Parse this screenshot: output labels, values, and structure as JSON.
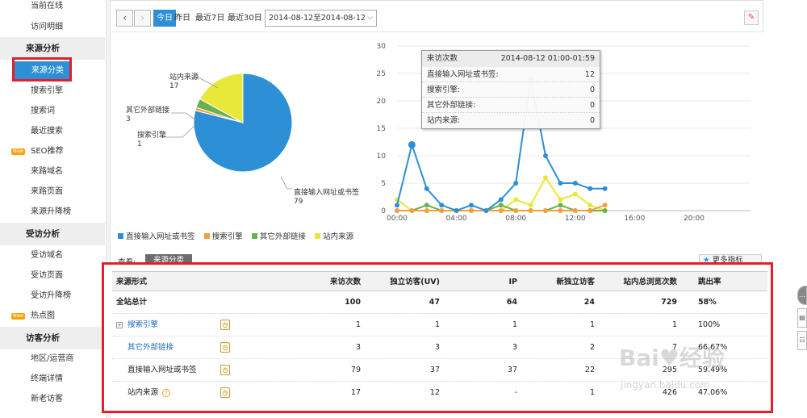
{
  "sidebar": {
    "items": [
      {
        "label": "当前在线",
        "type": "item"
      },
      {
        "label": "访问明细",
        "type": "item"
      },
      {
        "label": "来源分析",
        "type": "section"
      },
      {
        "label": "来源分类",
        "type": "item",
        "active": true
      },
      {
        "label": "搜索引擎",
        "type": "item"
      },
      {
        "label": "搜索词",
        "type": "item"
      },
      {
        "label": "最近搜索",
        "type": "item"
      },
      {
        "label": "SEO推荐",
        "type": "item",
        "badge": "New"
      },
      {
        "label": "来路域名",
        "type": "item"
      },
      {
        "label": "来路页面",
        "type": "item"
      },
      {
        "label": "来源升降榜",
        "type": "item"
      },
      {
        "label": "受访分析",
        "type": "section"
      },
      {
        "label": "受访域名",
        "type": "item"
      },
      {
        "label": "受访页面",
        "type": "item"
      },
      {
        "label": "受访升降榜",
        "type": "item"
      },
      {
        "label": "热点图",
        "type": "item",
        "badge": "New"
      },
      {
        "label": "访客分析",
        "type": "section"
      },
      {
        "label": "地区/运营商",
        "type": "item"
      },
      {
        "label": "终端详情",
        "type": "item"
      },
      {
        "label": "新老访客",
        "type": "item"
      }
    ]
  },
  "toolbar": {
    "prev_icon": "chevron-left-icon",
    "next_icon": "chevron-right-icon",
    "prev_glyph": "‹",
    "next_glyph": "›",
    "ranges": [
      "今日",
      "昨日",
      "最近7日",
      "最近30日"
    ],
    "date_range": "2014-08-12至2014-08-12",
    "date_chevron": "⌵",
    "pin_glyph": "✎"
  },
  "legend": {
    "items": [
      {
        "label": "直接输入网址或书签",
        "color": "#2d8fd5"
      },
      {
        "label": "搜索引擎",
        "color": "#f0a040"
      },
      {
        "label": "其它外部链接",
        "color": "#6ab04c"
      },
      {
        "label": "站内来源",
        "color": "#e8e83a"
      }
    ]
  },
  "chart_data": [
    {
      "type": "pie",
      "slices": [
        {
          "label": "直接输入网址或书签",
          "value": 79,
          "color": "#2d8fd5"
        },
        {
          "label": "搜索引擎",
          "value": 1,
          "color": "#f0a040"
        },
        {
          "label": "其它外部链接",
          "value": 3,
          "color": "#6ab04c"
        },
        {
          "label": "站内来源",
          "value": 17,
          "color": "#e8e83a"
        }
      ]
    },
    {
      "type": "line",
      "x_ticks": [
        "00:00",
        "04:00",
        "08:00",
        "12:00",
        "16:00",
        "20:00"
      ],
      "y_ticks": [
        0,
        5,
        10,
        15,
        20,
        25,
        30
      ],
      "ylim": [
        0,
        30
      ],
      "x_hours": [
        0,
        1,
        2,
        3,
        4,
        5,
        6,
        7,
        8,
        9,
        10,
        11,
        12,
        13,
        14
      ],
      "series": [
        {
          "name": "直接输入网址或书签",
          "color": "#2d8fd5",
          "values": [
            1,
            12,
            4,
            1,
            0,
            1,
            0,
            2,
            5,
            24,
            10,
            5,
            5,
            4,
            4
          ]
        },
        {
          "name": "搜索引擎",
          "color": "#f0a040",
          "values": [
            0,
            0,
            0,
            0,
            0,
            0,
            0,
            0,
            0,
            0,
            0,
            0,
            0,
            0,
            1
          ]
        },
        {
          "name": "其它外部链接",
          "color": "#6ab04c",
          "values": [
            0,
            0,
            1,
            0,
            0,
            0,
            0,
            1,
            0,
            0,
            0,
            1,
            0,
            0,
            0
          ]
        },
        {
          "name": "站内来源",
          "color": "#e8e83a",
          "values": [
            2,
            0,
            0,
            0,
            0,
            0,
            0,
            0,
            2,
            1,
            6,
            2,
            3,
            1,
            0
          ]
        }
      ]
    }
  ],
  "pie_labels": {
    "direct": {
      "name": "直接输入网址或书签",
      "value": "79"
    },
    "search": {
      "name": "搜索引擎",
      "value": "1"
    },
    "external": {
      "name": "其它外部链接",
      "value": "3"
    },
    "internal": {
      "name": "站内来源",
      "value": "17"
    }
  },
  "tooltip": {
    "title": "来访次数",
    "time": "2014-08-12 01:00-01:59",
    "rows": [
      {
        "label": "直接输入网址或书签:",
        "value": "12"
      },
      {
        "label": "搜索引擎:",
        "value": "0"
      },
      {
        "label": "其它外部链接:",
        "value": "0"
      },
      {
        "label": "站内来源:",
        "value": "0"
      }
    ]
  },
  "view": {
    "label": "查看:",
    "tab": "来源分类",
    "more": "更多指标"
  },
  "table": {
    "headers": [
      "来源形式",
      "来访次数",
      "独立访客(UV)",
      "IP",
      "新独立访客",
      "站内总浏览次数",
      "跳出率"
    ],
    "total": {
      "name": "全站总计",
      "visits": "100",
      "uv": "47",
      "ip": "64",
      "new": "24",
      "pv": "729",
      "bounce": "58%"
    },
    "rows": [
      {
        "name": "搜索引擎",
        "visits": "1",
        "uv": "1",
        "ip": "1",
        "new": "1",
        "pv": "1",
        "bounce": "100%",
        "expand": "+"
      },
      {
        "name": "其它外部链接",
        "visits": "3",
        "uv": "3",
        "ip": "3",
        "new": "2",
        "pv": "7",
        "bounce": "66.67%"
      },
      {
        "name": "直接输入网址或书签",
        "visits": "79",
        "uv": "37",
        "ip": "37",
        "new": "22",
        "pv": "295",
        "bounce": "59.49%"
      },
      {
        "name": "站内来源",
        "visits": "17",
        "uv": "12",
        "ip": "-",
        "new": "1",
        "pv": "426",
        "bounce": "47.06%",
        "help": "?"
      }
    ],
    "trend_icon_glyph": "◷"
  },
  "watermark": "Baidu经验 jingyan.baidu.com"
}
